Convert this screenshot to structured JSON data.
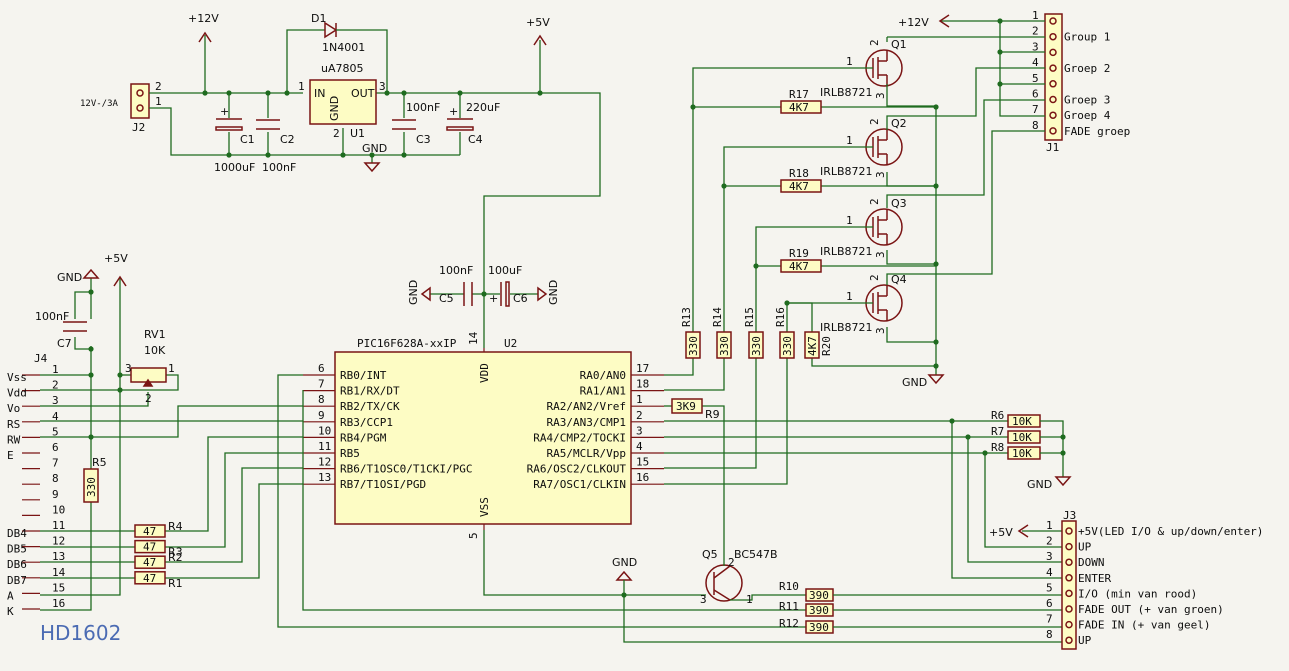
{
  "power": {
    "v12": "+12V",
    "v5": "+5V",
    "gnd": "GND"
  },
  "regulator": {
    "d1": {
      "ref": "D1",
      "value": "1N4001"
    },
    "u1": {
      "ref": "U1",
      "value": "uA7805",
      "pin_in": "IN",
      "pin_out": "OUT",
      "pin_gnd": "GND",
      "pin1": "1",
      "pin2": "2",
      "pin3": "3"
    },
    "j2": {
      "ref": "J2",
      "value": "12V-/3A",
      "pin1": "1",
      "pin2": "2"
    },
    "c1": {
      "ref": "C1",
      "value": "1000uF"
    },
    "c2": {
      "ref": "C2",
      "value": "100nF"
    },
    "c3": {
      "ref": "C3",
      "value": "100nF"
    },
    "c4": {
      "ref": "C4",
      "value": "220uF"
    }
  },
  "mcu": {
    "ref": "U2",
    "value": "PIC16F628A-xxIP",
    "vdd": "VDD",
    "vss": "VSS",
    "pin_vdd": "14",
    "pin_vss": "5",
    "left_pins": [
      {
        "num": "6",
        "name": "RB0/INT"
      },
      {
        "num": "7",
        "name": "RB1/RX/DT"
      },
      {
        "num": "8",
        "name": "RB2/TX/CK"
      },
      {
        "num": "9",
        "name": "RB3/CCP1"
      },
      {
        "num": "10",
        "name": "RB4/PGM"
      },
      {
        "num": "11",
        "name": "RB5"
      },
      {
        "num": "12",
        "name": "RB6/T1OSC0/T1CKI/PGC"
      },
      {
        "num": "13",
        "name": "RB7/T1OSI/PGD"
      }
    ],
    "right_pins": [
      {
        "num": "17",
        "name": "RA0/AN0"
      },
      {
        "num": "18",
        "name": "RA1/AN1"
      },
      {
        "num": "1",
        "name": "RA2/AN2/Vref"
      },
      {
        "num": "2",
        "name": "RA3/AN3/CMP1"
      },
      {
        "num": "3",
        "name": "RA4/CMP2/TOCKI"
      },
      {
        "num": "4",
        "name": "RA5/MCLR/Vpp"
      },
      {
        "num": "15",
        "name": "RA6/OSC2/CLKOUT"
      },
      {
        "num": "16",
        "name": "RA7/OSC1/CLKIN"
      }
    ]
  },
  "decoupling": {
    "c5": {
      "ref": "C5",
      "value": "100nF"
    },
    "c6": {
      "ref": "C6",
      "value": "100uF"
    },
    "c7": {
      "ref": "C7",
      "value": "100nF"
    }
  },
  "lcd": {
    "ref": "J4",
    "caption": "HD1602",
    "rv1": {
      "ref": "RV1",
      "value": "10K",
      "p1": "1",
      "p2": "2",
      "p3": "3"
    },
    "r5": {
      "ref": "R5",
      "value": "330"
    },
    "pins": [
      {
        "num": "1",
        "label": "Vss"
      },
      {
        "num": "2",
        "label": "Vdd"
      },
      {
        "num": "3",
        "label": "Vo"
      },
      {
        "num": "4",
        "label": "RS"
      },
      {
        "num": "5",
        "label": "RW"
      },
      {
        "num": "6",
        "label": "E"
      },
      {
        "num": "7",
        "label": ""
      },
      {
        "num": "8",
        "label": ""
      },
      {
        "num": "9",
        "label": ""
      },
      {
        "num": "10",
        "label": ""
      },
      {
        "num": "11",
        "label": "DB4"
      },
      {
        "num": "12",
        "label": "DB5"
      },
      {
        "num": "13",
        "label": "DB6"
      },
      {
        "num": "14",
        "label": "DB7"
      },
      {
        "num": "15",
        "label": "A"
      },
      {
        "num": "16",
        "label": "K"
      }
    ],
    "data_resistors": [
      {
        "ref": "R4",
        "value": "47"
      },
      {
        "ref": "R3",
        "value": "47"
      },
      {
        "ref": "R2",
        "value": "47"
      },
      {
        "ref": "R1",
        "value": "47"
      }
    ]
  },
  "mosfets": [
    {
      "ref": "Q1",
      "value": "IRLB8721",
      "gate_res": {
        "ref": "R13",
        "value": "330"
      },
      "pull_res": {
        "ref": "R17",
        "value": "4K7"
      }
    },
    {
      "ref": "Q2",
      "value": "IRLB8721",
      "gate_res": {
        "ref": "R14",
        "value": "330"
      },
      "pull_res": {
        "ref": "R18",
        "value": "4K7"
      }
    },
    {
      "ref": "Q3",
      "value": "IRLB8721",
      "gate_res": {
        "ref": "R15",
        "value": "330"
      },
      "pull_res": {
        "ref": "R19",
        "value": "4K7"
      }
    },
    {
      "ref": "Q4",
      "value": "IRLB8721",
      "gate_res": {
        "ref": "R16",
        "value": "330"
      },
      "pull_res": {
        "ref": "R20",
        "value": "4K7"
      }
    }
  ],
  "mosfet_pins": {
    "g": "1",
    "d": "2",
    "s": "3"
  },
  "j1": {
    "ref": "J1",
    "pins": [
      {
        "num": "1",
        "label": ""
      },
      {
        "num": "2",
        "label": "Group 1"
      },
      {
        "num": "3",
        "label": ""
      },
      {
        "num": "4",
        "label": "Groep 2"
      },
      {
        "num": "5",
        "label": ""
      },
      {
        "num": "6",
        "label": "Groep 3"
      },
      {
        "num": "7",
        "label": "Groep 4"
      },
      {
        "num": "8",
        "label": "FADE groep"
      }
    ]
  },
  "buttons_pullups": [
    {
      "ref": "R6",
      "value": "10K"
    },
    {
      "ref": "R7",
      "value": "10K"
    },
    {
      "ref": "R8",
      "value": "10K"
    }
  ],
  "r9": {
    "ref": "R9",
    "value": "3K9"
  },
  "q5": {
    "ref": "Q5",
    "value": "BC547B",
    "p1": "1",
    "p2": "2",
    "p3": "3"
  },
  "led_res": [
    {
      "ref": "R10",
      "value": "390"
    },
    {
      "ref": "R11",
      "value": "390"
    },
    {
      "ref": "R12",
      "value": "390"
    }
  ],
  "j3": {
    "ref": "J3",
    "pins": [
      {
        "num": "1",
        "label": "+5V(LED I/O & up/down/enter)"
      },
      {
        "num": "2",
        "label": "UP"
      },
      {
        "num": "3",
        "label": "DOWN"
      },
      {
        "num": "4",
        "label": "ENTER"
      },
      {
        "num": "5",
        "label": "I/O (min van rood)"
      },
      {
        "num": "6",
        "label": "FADE OUT (+ van groen)"
      },
      {
        "num": "7",
        "label": "FADE IN (+ van geel)"
      },
      {
        "num": "8",
        "label": "UP"
      }
    ]
  }
}
